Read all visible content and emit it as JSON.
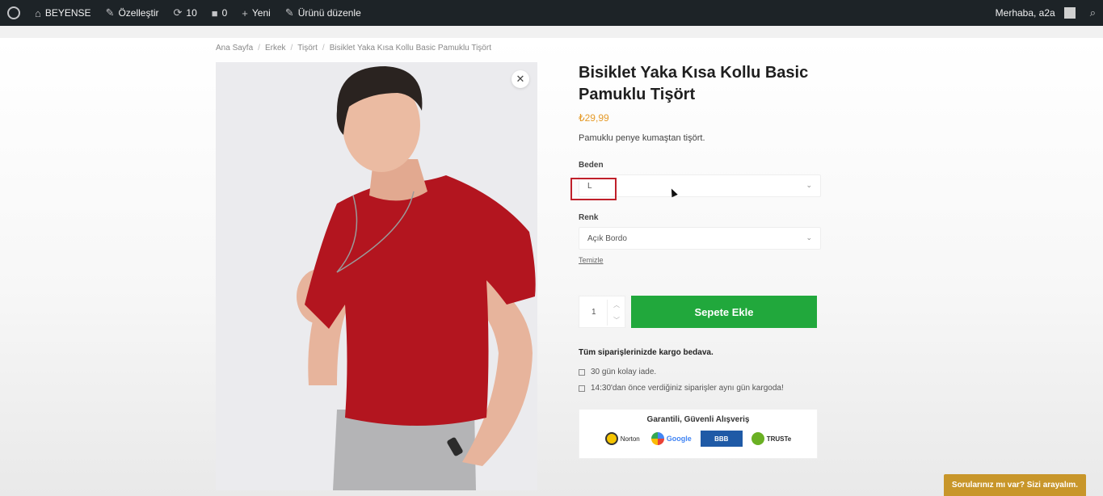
{
  "adminbar": {
    "site": "BEYENSE",
    "customize": "Özelleştir",
    "updates": "10",
    "comments": "0",
    "new": "Yeni",
    "edit_product": "Ürünü düzenle",
    "greeting": "Merhaba, a2a"
  },
  "breadcrumb": [
    "Ana Sayfa",
    "Erkek",
    "Tişört",
    "Bisiklet Yaka Kısa Kollu Basic Pamuklu Tişört"
  ],
  "product": {
    "title": "Bisiklet Yaka Kısa Kollu Basic Pamuklu Tişört",
    "price": "₺29,99",
    "short_description": "Pamuklu penye kumaştan tişört.",
    "size_label": "Beden",
    "size_value": "L",
    "color_label": "Renk",
    "color_value": "Açık Bordo",
    "clear_label": "Temizle",
    "quantity": "1",
    "add_to_cart": "Sepete Ekle",
    "shipping_note": "Tüm siparişlerinizde kargo bedava.",
    "bullets": [
      "30 gün kolay iade.",
      "14:30'dan önce verdiğiniz siparişler aynı gün kargoda!"
    ],
    "trust_title": "Garantili, Güvenli Alışveriş",
    "badges": [
      "Norton",
      "Google",
      "BBB",
      "TRUSTe"
    ],
    "shirt_color": "#b3151f"
  },
  "chat": {
    "label": "Sorularınız mı var? Sizi arayalım."
  }
}
